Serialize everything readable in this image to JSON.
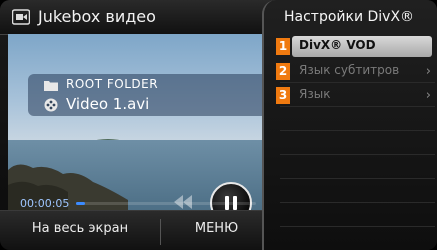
{
  "app": {
    "title": "Jukebox видео"
  },
  "file_info": {
    "folder_label": "ROOT FOLDER",
    "file_name": "Video 1.avi"
  },
  "playback": {
    "current_time": "00:00:05",
    "progress_fraction": 0.05,
    "state": "playing"
  },
  "bottom_bar": {
    "fullscreen_label": "На весь экран",
    "menu_label": "МЕНЮ"
  },
  "settings_panel": {
    "title": "Настройки DivX®",
    "items": [
      {
        "number": "1",
        "label": "DivX® VOD",
        "selected": true,
        "has_submenu": false
      },
      {
        "number": "2",
        "label": "Язык субтитров",
        "selected": false,
        "has_submenu": true
      },
      {
        "number": "3",
        "label": "Язык",
        "selected": false,
        "has_submenu": true
      }
    ],
    "chevron": "›"
  },
  "colors": {
    "accent_orange": "#f07a10",
    "progress_blue": "#3b8bff"
  }
}
